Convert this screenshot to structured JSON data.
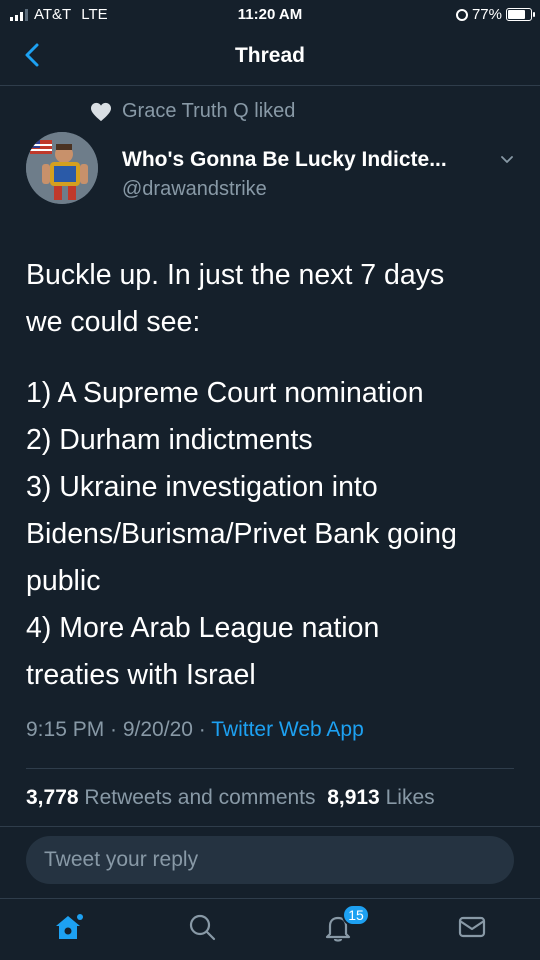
{
  "status_bar": {
    "carrier": "AT&T",
    "network": "LTE",
    "time": "11:20 AM",
    "battery": "77%",
    "battery_level": 0.77
  },
  "nav": {
    "title": "Thread",
    "back_icon": "chevron-left-icon"
  },
  "liked": {
    "text": "Grace Truth Q liked"
  },
  "author": {
    "name": "Who's Gonna Be Lucky Indicte...",
    "handle": "@drawandstrike"
  },
  "tweet": {
    "lines": [
      "Buckle up. In just the next 7 days",
      "we could see:",
      "1) A Supreme Court nomination",
      "2) Durham indictments",
      "3) Ukraine investigation into",
      "Bidens/Burisma/Privet Bank going",
      "public",
      "4) More Arab League nation",
      "treaties with Israel"
    ],
    "time": "9:15 PM · 9/20/20 ·",
    "app": "Twitter Web App"
  },
  "stats": {
    "retweets_count": "3,778",
    "retweets_label": "Retweets and comments",
    "likes_count": "8,913",
    "likes_label": "Likes"
  },
  "reply": {
    "placeholder": "Tweet your reply"
  },
  "tabbar": {
    "notifications_badge": "15",
    "accent": "#1da1f2"
  }
}
